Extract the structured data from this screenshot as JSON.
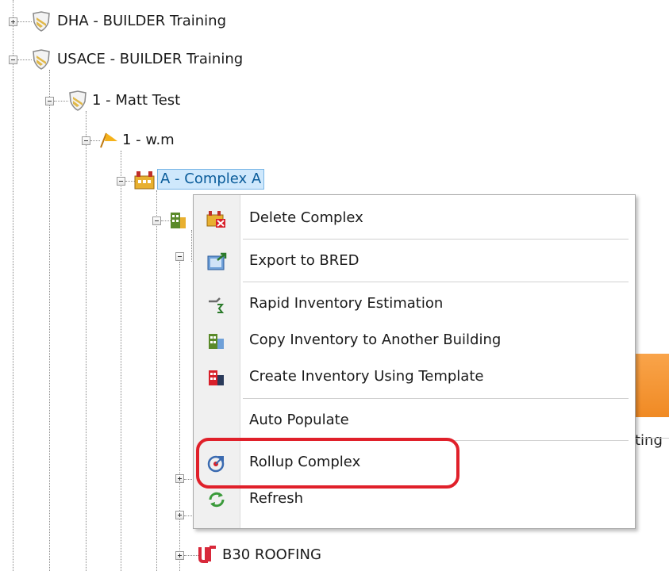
{
  "tree": {
    "items": [
      {
        "label": "DHA - BUILDER Training",
        "icon": "shield-icon"
      },
      {
        "label": "USACE - BUILDER Training",
        "icon": "shield-icon"
      },
      {
        "label": "1 - Matt Test",
        "icon": "shield-icon"
      },
      {
        "label": "1 - w.m",
        "icon": "flag-icon"
      },
      {
        "label": "A - Complex A",
        "icon": "complex-icon",
        "selected": true
      },
      {
        "label": "B30 ROOFING",
        "icon": "pipe-icon"
      }
    ],
    "partial_text": "ting"
  },
  "context_menu": {
    "items": [
      {
        "label": "Delete Complex",
        "icon": "delete-complex-icon"
      },
      {
        "label": "Export to BRED",
        "icon": "export-icon"
      },
      {
        "label": "Rapid Inventory Estimation",
        "icon": "estimation-icon"
      },
      {
        "label": "Copy Inventory to Another Building",
        "icon": "copy-inventory-icon"
      },
      {
        "label": "Create Inventory Using Template",
        "icon": "template-icon"
      },
      {
        "label": "Auto Populate",
        "icon": ""
      },
      {
        "label": "Rollup Complex",
        "icon": "rollup-icon",
        "highlighted": true
      },
      {
        "label": "Refresh",
        "icon": "refresh-icon"
      }
    ]
  },
  "colors": {
    "selection": "#cfe8fc",
    "highlight_ring": "#e0202a",
    "accent_orange": "#f08a24"
  }
}
